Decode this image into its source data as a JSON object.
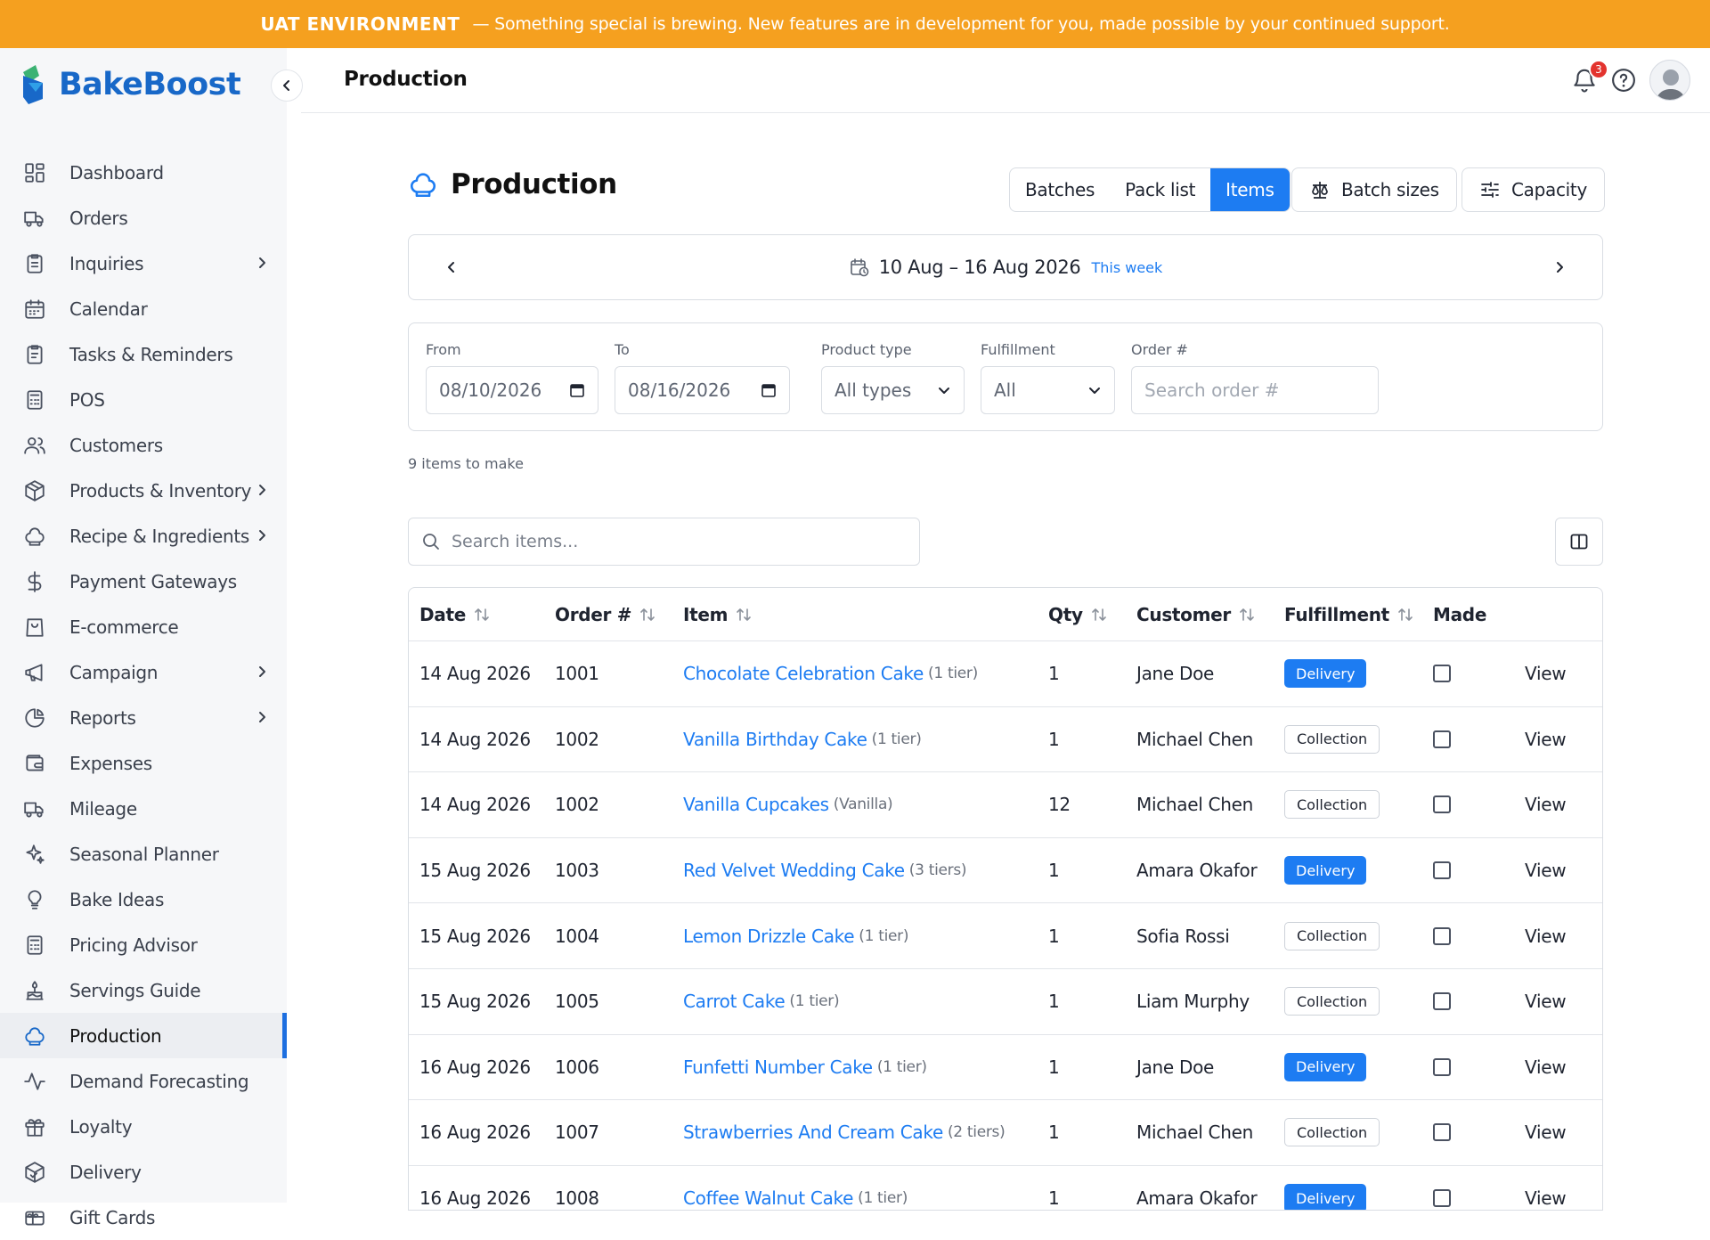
{
  "banner": {
    "tag": "UAT ENVIRONMENT",
    "message": "— Something special is brewing. New features are in development for you, made possible by your continued support."
  },
  "brand": {
    "name": "BakeBoost"
  },
  "sidebar": {
    "items": [
      {
        "label": "Dashboard",
        "icon": "dashboard-icon",
        "has_submenu": false
      },
      {
        "label": "Orders",
        "icon": "truck-icon",
        "has_submenu": false
      },
      {
        "label": "Inquiries",
        "icon": "clipboard-icon",
        "has_submenu": true
      },
      {
        "label": "Calendar",
        "icon": "calendar-icon",
        "has_submenu": false
      },
      {
        "label": "Tasks & Reminders",
        "icon": "clipboard-check-icon",
        "has_submenu": false
      },
      {
        "label": "POS",
        "icon": "calculator-icon",
        "has_submenu": false
      },
      {
        "label": "Customers",
        "icon": "users-icon",
        "has_submenu": false
      },
      {
        "label": "Products & Inventory",
        "icon": "box-icon",
        "has_submenu": true
      },
      {
        "label": "Recipe & Ingredients",
        "icon": "chef-hat-icon",
        "has_submenu": true
      },
      {
        "label": "Payment Gateways",
        "icon": "dollar-icon",
        "has_submenu": false
      },
      {
        "label": "E-commerce",
        "icon": "shopping-bag-icon",
        "has_submenu": false
      },
      {
        "label": "Campaign",
        "icon": "megaphone-icon",
        "has_submenu": true
      },
      {
        "label": "Reports",
        "icon": "pie-chart-icon",
        "has_submenu": true
      },
      {
        "label": "Expenses",
        "icon": "wallet-icon",
        "has_submenu": false
      },
      {
        "label": "Mileage",
        "icon": "truck-icon",
        "has_submenu": false
      },
      {
        "label": "Seasonal Planner",
        "icon": "sparkles-icon",
        "has_submenu": false
      },
      {
        "label": "Bake Ideas",
        "icon": "lightbulb-icon",
        "has_submenu": false
      },
      {
        "label": "Pricing Advisor",
        "icon": "calculator-icon",
        "has_submenu": false
      },
      {
        "label": "Servings Guide",
        "icon": "cake-icon",
        "has_submenu": false
      },
      {
        "label": "Production",
        "icon": "chef-hat-icon",
        "has_submenu": false,
        "active": true
      },
      {
        "label": "Demand Forecasting",
        "icon": "activity-icon",
        "has_submenu": false
      },
      {
        "label": "Loyalty",
        "icon": "gift-icon",
        "has_submenu": false
      },
      {
        "label": "Delivery",
        "icon": "package-check-icon",
        "has_submenu": false
      },
      {
        "label": "Gift Cards",
        "icon": "gift-card-icon",
        "has_submenu": false
      }
    ]
  },
  "topbar": {
    "title": "Production",
    "notification_count": "3"
  },
  "page": {
    "title": "Production",
    "view_tabs": [
      {
        "label": "Batches",
        "active": false
      },
      {
        "label": "Pack list",
        "active": false
      },
      {
        "label": "Items",
        "active": true
      }
    ],
    "batch_sizes_label": "Batch sizes",
    "capacity_label": "Capacity"
  },
  "week_nav": {
    "range": "10 Aug – 16 Aug 2026",
    "this_week_label": "This week"
  },
  "filters": {
    "from_label": "From",
    "from_value": "08/10/2026",
    "to_label": "To",
    "to_value": "08/16/2026",
    "product_type_label": "Product type",
    "product_type_value": "All types",
    "fulfillment_label": "Fulfillment",
    "fulfillment_value": "All",
    "order_label": "Order #",
    "order_placeholder": "Search order #"
  },
  "summary": {
    "count_text": "9 items to make"
  },
  "search": {
    "placeholder": "Search items..."
  },
  "table": {
    "columns": {
      "date": "Date",
      "order": "Order #",
      "item": "Item",
      "qty": "Qty",
      "customer": "Customer",
      "fulfillment": "Fulfillment",
      "made": "Made"
    },
    "rows": [
      {
        "date": "14 Aug 2026",
        "order": "1001",
        "item": "Chocolate Celebration Cake",
        "variant": "(1 tier)",
        "qty": "1",
        "customer": "Jane Doe",
        "fulfillment": "Delivery",
        "made": false,
        "action": "View"
      },
      {
        "date": "14 Aug 2026",
        "order": "1002",
        "item": "Vanilla Birthday Cake",
        "variant": "(1 tier)",
        "qty": "1",
        "customer": "Michael Chen",
        "fulfillment": "Collection",
        "made": false,
        "action": "View"
      },
      {
        "date": "14 Aug 2026",
        "order": "1002",
        "item": "Vanilla Cupcakes",
        "variant": "(Vanilla)",
        "qty": "12",
        "customer": "Michael Chen",
        "fulfillment": "Collection",
        "made": false,
        "action": "View"
      },
      {
        "date": "15 Aug 2026",
        "order": "1003",
        "item": "Red Velvet Wedding Cake",
        "variant": "(3 tiers)",
        "qty": "1",
        "customer": "Amara Okafor",
        "fulfillment": "Delivery",
        "made": false,
        "action": "View"
      },
      {
        "date": "15 Aug 2026",
        "order": "1004",
        "item": "Lemon Drizzle Cake",
        "variant": "(1 tier)",
        "qty": "1",
        "customer": "Sofia Rossi",
        "fulfillment": "Collection",
        "made": false,
        "action": "View"
      },
      {
        "date": "15 Aug 2026",
        "order": "1005",
        "item": "Carrot Cake",
        "variant": "(1 tier)",
        "qty": "1",
        "customer": "Liam Murphy",
        "fulfillment": "Collection",
        "made": false,
        "action": "View"
      },
      {
        "date": "16 Aug 2026",
        "order": "1006",
        "item": "Funfetti Number Cake",
        "variant": "(1 tier)",
        "qty": "1",
        "customer": "Jane Doe",
        "fulfillment": "Delivery",
        "made": false,
        "action": "View"
      },
      {
        "date": "16 Aug 2026",
        "order": "1007",
        "item": "Strawberries And Cream Cake",
        "variant": "(2 tiers)",
        "qty": "1",
        "customer": "Michael Chen",
        "fulfillment": "Collection",
        "made": false,
        "action": "View"
      },
      {
        "date": "16 Aug 2026",
        "order": "1008",
        "item": "Coffee Walnut Cake",
        "variant": "(1 tier)",
        "qty": "1",
        "customer": "Amara Okafor",
        "fulfillment": "Delivery",
        "made": false,
        "action": "View"
      }
    ]
  },
  "colors": {
    "banner": "#f5a01f",
    "accent": "#1d7cf2",
    "brand": "#1868c8",
    "notification": "#e3342f"
  }
}
